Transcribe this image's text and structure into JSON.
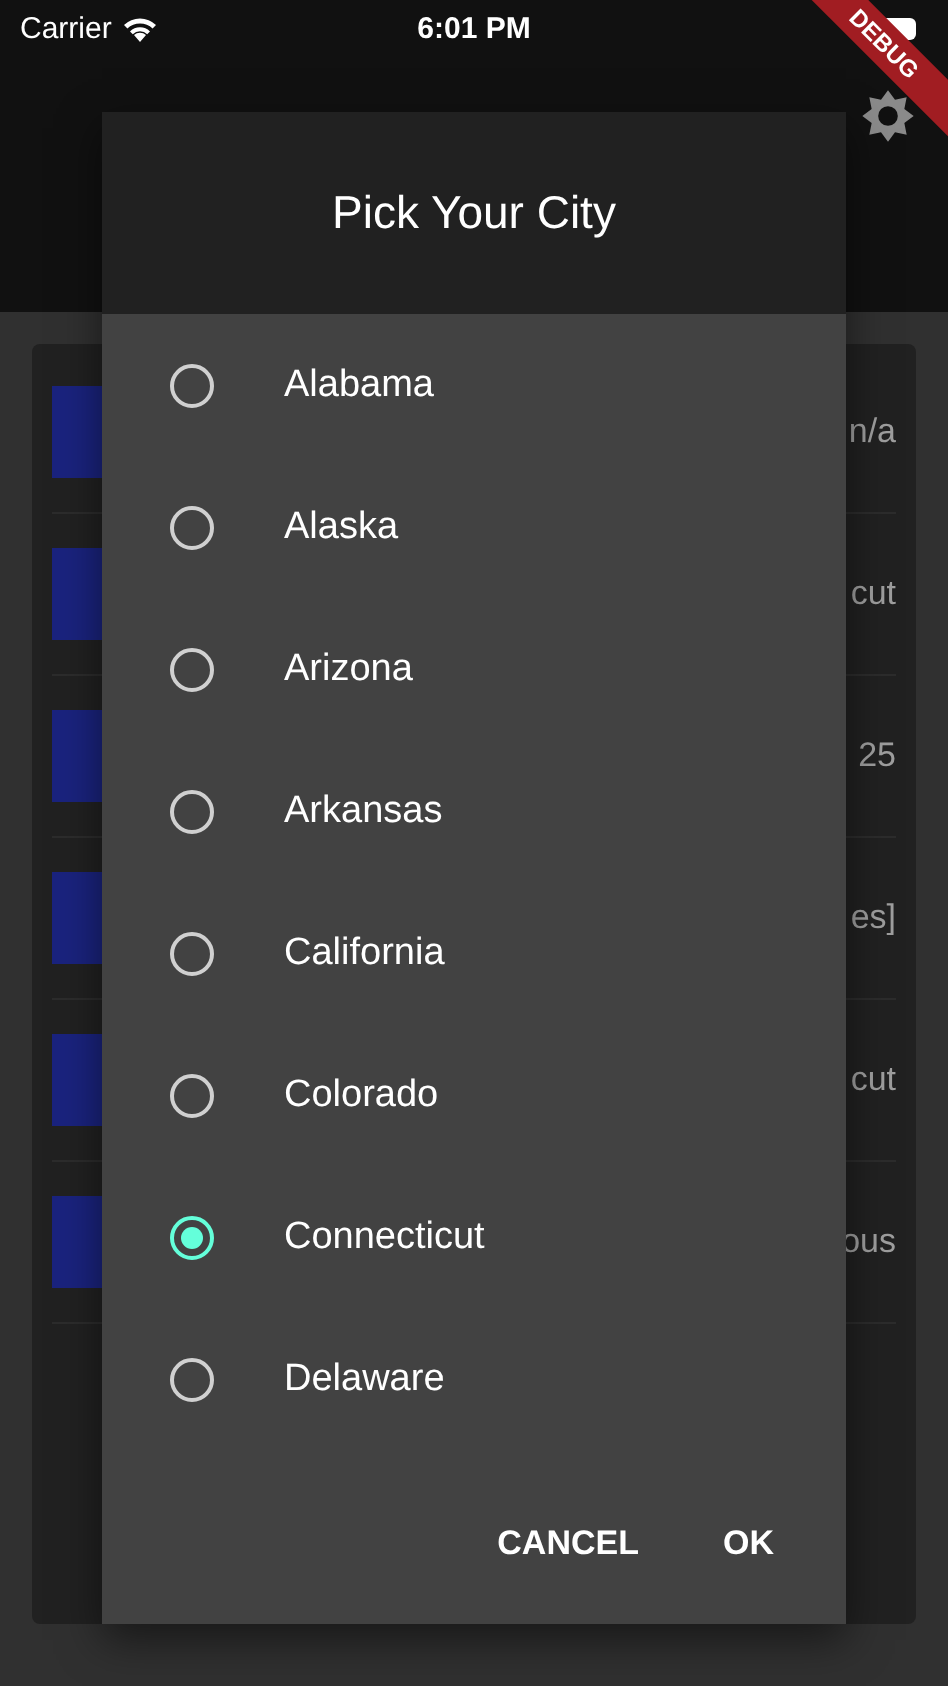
{
  "status_bar": {
    "carrier": "Carrier",
    "time": "6:01 PM"
  },
  "debug_banner": "DEBUG",
  "background_list": [
    {
      "trailing": "n/a"
    },
    {
      "trailing": "cut"
    },
    {
      "trailing": "25"
    },
    {
      "trailing": "es]"
    },
    {
      "trailing": "cut"
    },
    {
      "trailing": "ous"
    }
  ],
  "dialog": {
    "title": "Pick Your City",
    "options": [
      {
        "label": "Alabama",
        "selected": false
      },
      {
        "label": "Alaska",
        "selected": false
      },
      {
        "label": "Arizona",
        "selected": false
      },
      {
        "label": "Arkansas",
        "selected": false
      },
      {
        "label": "California",
        "selected": false
      },
      {
        "label": "Colorado",
        "selected": false
      },
      {
        "label": "Connecticut",
        "selected": true
      },
      {
        "label": "Delaware",
        "selected": false
      }
    ],
    "buttons": [
      "CANCEL",
      "OK"
    ]
  }
}
